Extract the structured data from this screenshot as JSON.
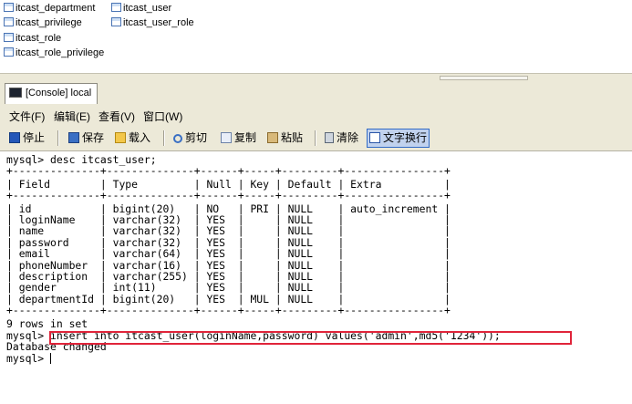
{
  "table_list": [
    {
      "label": "itcast_department"
    },
    {
      "label": "itcast_user"
    },
    {
      "label": "itcast_privilege"
    },
    {
      "label": "itcast_user_role"
    },
    {
      "label": "itcast_role"
    },
    {
      "label": "itcast_role_privilege"
    }
  ],
  "tab": {
    "label": "[Console] local"
  },
  "menu": [
    "文件(F)",
    "编辑(E)",
    "查看(V)",
    "窗口(W)"
  ],
  "toolbar": {
    "stop": "停止",
    "save": "保存",
    "load": "载入",
    "cut": "剪切",
    "copy": "复制",
    "paste": "粘贴",
    "clear": "清除",
    "wrap": "文字换行"
  },
  "console": {
    "lines": [
      "mysql> desc itcast_user;",
      "+--------------+--------------+------+-----+---------+----------------+",
      "| Field        | Type         | Null | Key | Default | Extra          |",
      "+--------------+--------------+------+-----+---------+----------------+",
      "| id           | bigint(20)   | NO   | PRI | NULL    | auto_increment |",
      "| loginName    | varchar(32)  | YES  |     | NULL    |                |",
      "| name         | varchar(32)  | YES  |     | NULL    |                |",
      "| password     | varchar(32)  | YES  |     | NULL    |                |",
      "| email        | varchar(64)  | YES  |     | NULL    |                |",
      "| phoneNumber  | varchar(16)  | YES  |     | NULL    |                |",
      "| description  | varchar(255) | YES  |     | NULL    |                |",
      "| gender       | int(11)      | YES  |     | NULL    |                |",
      "| departmentId | bigint(20)   | YES  | MUL | NULL    |                |",
      "+--------------+--------------+------+-----+---------+----------------+",
      "9 rows in set",
      "",
      "mysql> insert into itcast_user(loginName,password) values('admin',md5('1234'));",
      "Database changed",
      "mysql> "
    ]
  },
  "colors": {
    "highlight_border": "#e0243a",
    "chrome": "#ece9d8"
  }
}
